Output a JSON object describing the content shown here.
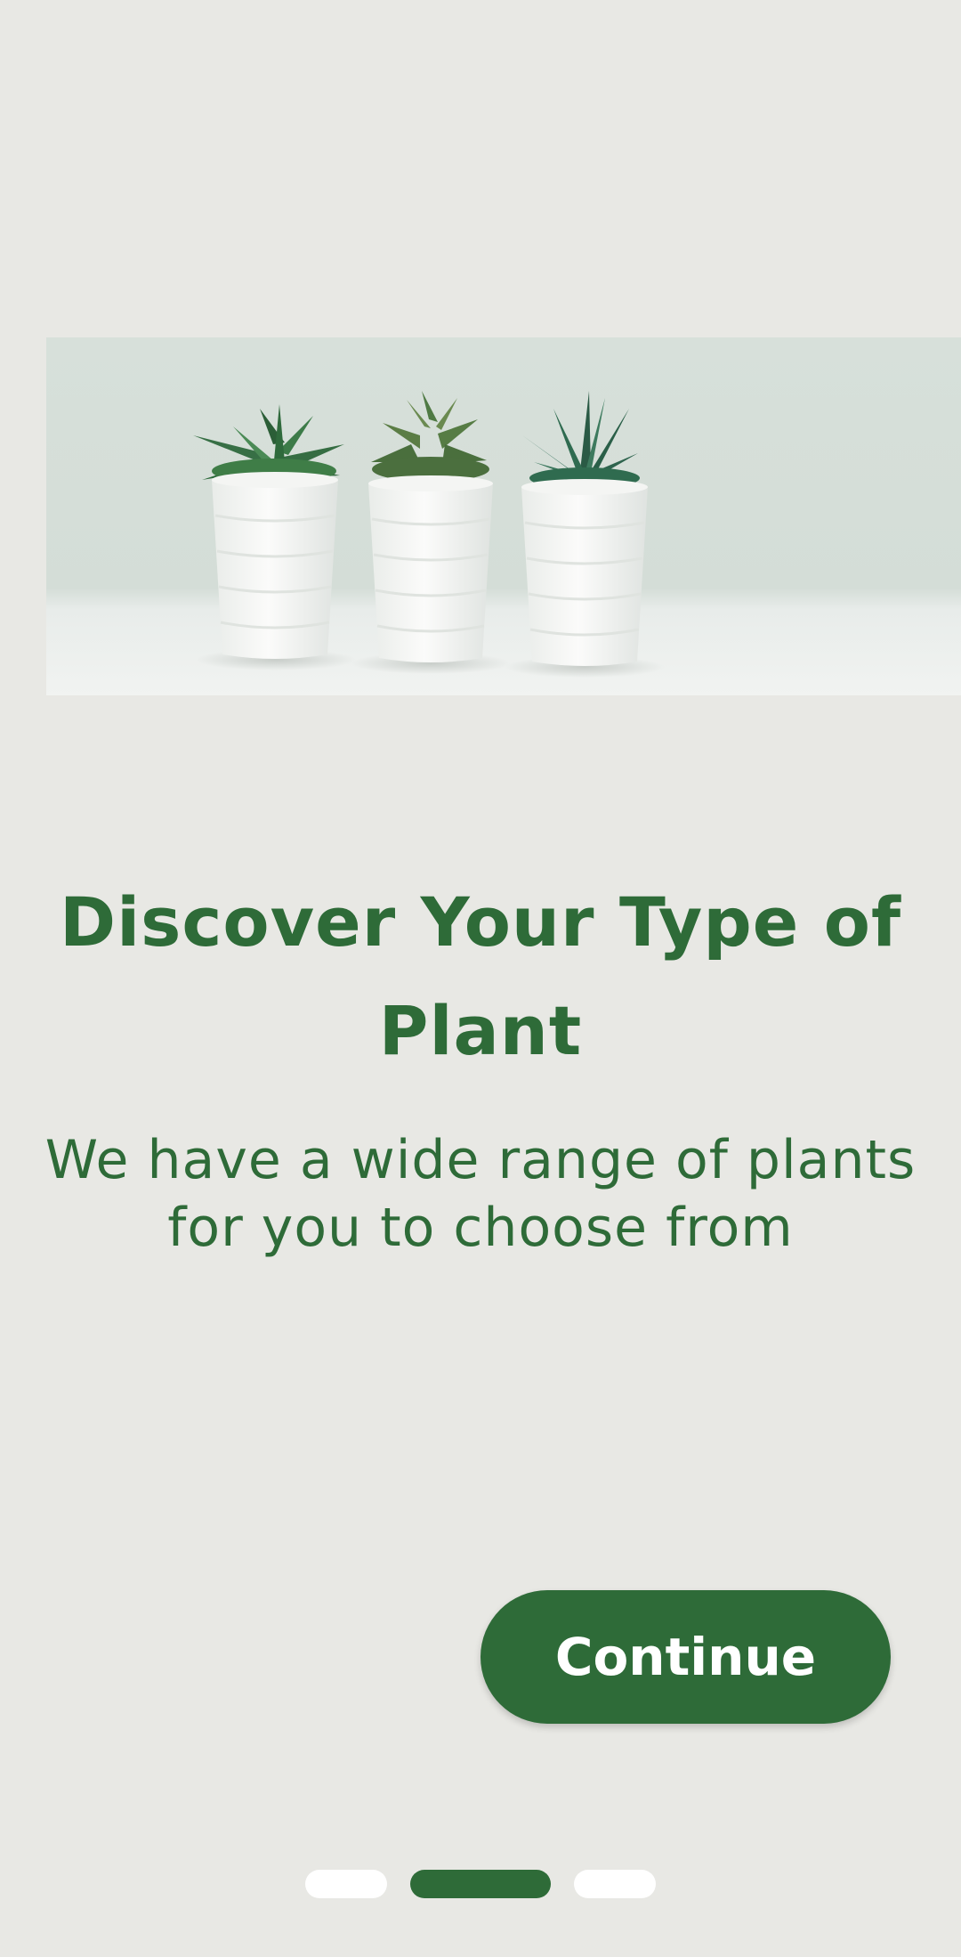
{
  "onboarding": {
    "title": "Discover Your Type of Plant",
    "subtitle": "We have a wide range of plants for you to choose from",
    "continue_label": "Continue",
    "hero_image": "succulent-pots-image",
    "page_indicator": {
      "total": 3,
      "active_index": 1
    }
  },
  "colors": {
    "background": "#e8e8e4",
    "primary_green": "#2e6b38",
    "inactive_dot": "#ffffff"
  }
}
